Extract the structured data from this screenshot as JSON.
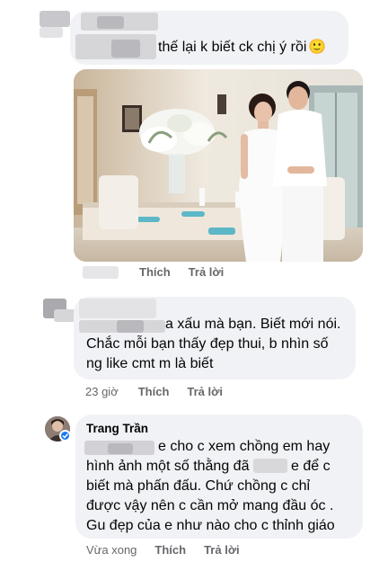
{
  "comment1": {
    "text_visible": "thế lại k biết ck chị ý rồi",
    "emoji": "🙂"
  },
  "photo": {
    "icon": "wedding-photo"
  },
  "comment1_actions": {
    "like": "Thích",
    "reply": "Trả lời"
  },
  "comment2": {
    "line1": "a xấu mà bạn. Biết mới nói.",
    "line2": "Chắc mỗi bạn thấy đẹp thui, b nhìn số",
    "line3": "ng like cmt m là biết",
    "time": "23 giờ",
    "like": "Thích",
    "reply": "Trả lời"
  },
  "comment3": {
    "author": "Trang Trần",
    "line1": "e cho c xem chồng em hay",
    "line2a": "hình ảnh một số thằng đã",
    "line2b": "e để c",
    "line3": "biết mà phấn đấu. Chứ chồng c chỉ",
    "line4": "được vậy nên c cần mở mang đầu óc .",
    "line5": "Gu đẹp của e như nào cho c thỉnh giáo",
    "time": "Vừa xong",
    "like": "Thích",
    "reply": "Trả lời"
  }
}
